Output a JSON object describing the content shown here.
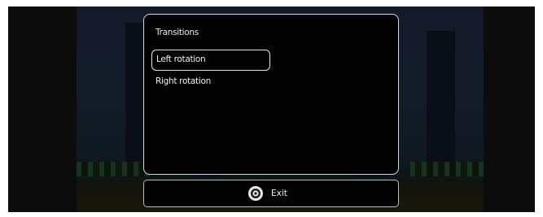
{
  "menu": {
    "title": "Transitions",
    "items": [
      {
        "label": "Left rotation",
        "selected": true
      },
      {
        "label": "Right rotation",
        "selected": false
      }
    ]
  },
  "footer": {
    "exit_label": "Exit",
    "exit_icon": "remote-button-icon"
  },
  "colors": {
    "panel_background": "#020202",
    "panel_border": "#d8d8d8",
    "text": "#f0f0f0"
  }
}
